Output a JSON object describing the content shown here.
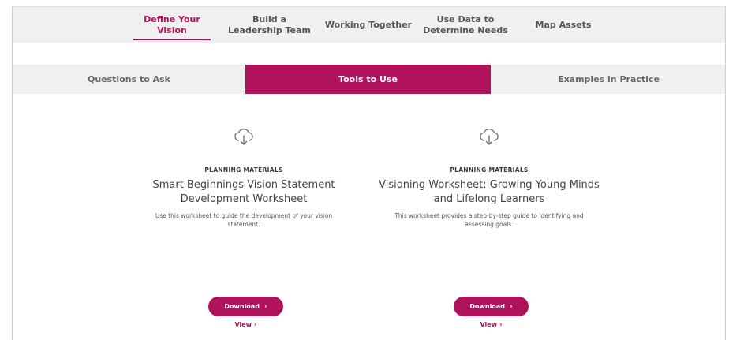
{
  "topnav": {
    "items": [
      {
        "label": "Define Your Vision",
        "active": true
      },
      {
        "label": "Build a Leadership Team",
        "active": false
      },
      {
        "label": "Working Together",
        "active": false
      },
      {
        "label": "Use Data to Determine Needs",
        "active": false
      },
      {
        "label": "Map Assets",
        "active": false
      }
    ]
  },
  "tabs": [
    {
      "label": "Questions to Ask",
      "active": false
    },
    {
      "label": "Tools to Use",
      "active": true
    },
    {
      "label": "Examples in Practice",
      "active": false
    }
  ],
  "cards": [
    {
      "icon": "cloud-download-icon",
      "category": "PLANNING MATERIALS",
      "title": "Smart Beginnings Vision Statement Development Worksheet",
      "description": "Use this worksheet to guide the development of your vision statement.",
      "download_label": "Download",
      "view_label": "View"
    },
    {
      "icon": "cloud-download-icon",
      "category": "PLANNING MATERIALS",
      "title": "Visioning Worksheet: Growing Young Minds and Lifelong Learners",
      "description": "This worksheet provides a step-by-step guide to identifying and assessing goals.",
      "download_label": "Download",
      "view_label": "View"
    }
  ],
  "colors": {
    "accent": "#b0135c",
    "bar_bg": "#f0f0f0"
  },
  "chevron": "›"
}
